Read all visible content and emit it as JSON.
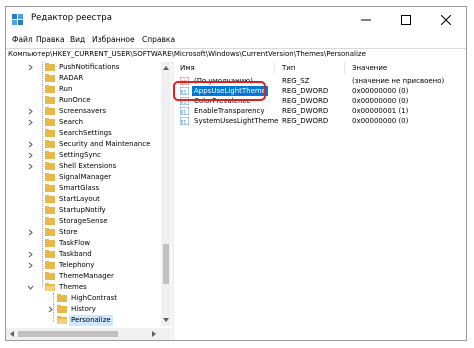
{
  "window": {
    "title": "Редактор реестра",
    "icon": "registry-editor-icon"
  },
  "menu": {
    "items": [
      "Файл",
      "Правка",
      "Вид",
      "Избранное",
      "Справка"
    ]
  },
  "address": {
    "path": "Компьютер\\HKEY_CURRENT_USER\\SOFTWARE\\Microsoft\\Windows\\CurrentVersion\\Themes\\Personalize"
  },
  "tree": {
    "items": [
      {
        "label": "PushNotifications"
      },
      {
        "label": "RADAR"
      },
      {
        "label": "Run"
      },
      {
        "label": "RunOnce"
      },
      {
        "label": "Screensavers"
      },
      {
        "label": "Search"
      },
      {
        "label": "SearchSettings"
      },
      {
        "label": "Security and Maintenance"
      },
      {
        "label": "SettingSync"
      },
      {
        "label": "Shell Extensions"
      },
      {
        "label": "SignalManager"
      },
      {
        "label": "SmartGlass"
      },
      {
        "label": "StartLayout"
      },
      {
        "label": "StartupNotify"
      },
      {
        "label": "StorageSense"
      },
      {
        "label": "Store"
      },
      {
        "label": "TaskFlow"
      },
      {
        "label": "Taskband"
      },
      {
        "label": "Telephony"
      },
      {
        "label": "ThemeManager"
      },
      {
        "label": "Themes"
      },
      {
        "label": "HighContrast"
      },
      {
        "label": "History"
      },
      {
        "label": "Personalize"
      }
    ],
    "selected": "Personalize"
  },
  "list": {
    "columns": [
      "Имя",
      "Тип",
      "Значение"
    ],
    "rows": [
      {
        "name": "(По умолчанию)",
        "type": "REG_SZ",
        "value": "(значение не присвоено)",
        "icon": "string-value-icon"
      },
      {
        "name": "AppsUseLightTheme",
        "type": "REG_DWORD",
        "value": "0x00000000 (0)",
        "icon": "dword-value-icon"
      },
      {
        "name": "ColorPrevalence",
        "type": "REG_DWORD",
        "value": "0x00000000 (0)",
        "icon": "dword-value-icon"
      },
      {
        "name": "EnableTransparency",
        "type": "REG_DWORD",
        "value": "0x00000001 (1)",
        "icon": "dword-value-icon"
      },
      {
        "name": "SystemUsesLightTheme",
        "type": "REG_DWORD",
        "value": "0x00000000 (0)",
        "icon": "dword-value-icon"
      }
    ],
    "selected": "AppsUseLightTheme"
  },
  "colors": {
    "selection": "#0078d7",
    "tree_selection": "#cde8ff",
    "highlight_annotation": "#e02020",
    "folder": "#e8b84a"
  }
}
